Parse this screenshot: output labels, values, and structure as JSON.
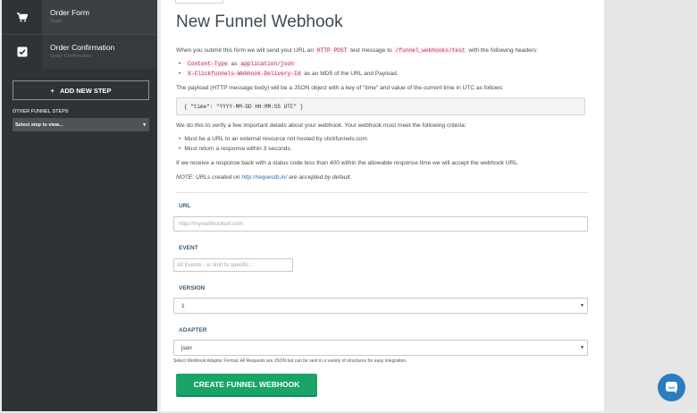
{
  "sidebar": {
    "steps": [
      {
        "name": "Order Form",
        "sub": "Order",
        "icon": "cart-icon"
      },
      {
        "name": "Order Confirmation",
        "sub": "Order Confirmation",
        "icon": "checkbox-icon"
      }
    ],
    "add_step_label": "ADD NEW STEP",
    "other_steps_label": "OTHER FUNNEL STEPS",
    "select_placeholder": "Select step to view..."
  },
  "main": {
    "title": "New Funnel Webhook",
    "intro_1": "When you submit this form we will send your URL an",
    "intro_code_1": "HTTP POST",
    "intro_2": "test message to",
    "intro_code_2": "/funnel_webhooks/test",
    "intro_3": "with the following headers:",
    "headers": [
      {
        "code": "Content-Type",
        "mid": "as",
        "code2": "application/json",
        "tail": ""
      },
      {
        "code": "X-Clickfunnels-Webhook-Delivery-Id",
        "mid": "as an MD5 of the URL and Payload.",
        "code2": "",
        "tail": ""
      }
    ],
    "payload_text": "The payload (HTTP message body) will be a JSON object with a key of \"time\" and value of the current time in UTC as follows:",
    "payload_example": "{ \"time\": \"YYYY-MM-DD HH:MM:SS UTC\" }",
    "verify_text": "We do this to verify a few important details about your webhook. Your webhook must meet the following criteria:",
    "criteria": [
      "Must be a URL to an external resource not hosted by clickfunnels.com",
      "Must return a response within 3 seconds."
    ],
    "accept_text": "If we receive a response back with a status code less than 400 within the allowable response time we will accept the webhook URL.",
    "note_prefix": "NOTE: URLs created on",
    "note_link": "http://requestb.in/",
    "note_suffix": "are accepted by default.",
    "url_label": "URL",
    "url_placeholder": "http://mywebhookurl.com",
    "event_label": "EVENT",
    "event_placeholder": "All Events - or limit to specific...",
    "version_label": "VERSION",
    "version_value": "1",
    "adapter_label": "ADAPTER",
    "adapter_value": "json",
    "adapter_help": "Select Webhook Adaptor Format. All Requests are JSON but can be sent in a variety of structures for easy integration.",
    "create_button": "CREATE FUNNEL WEBHOOK"
  },
  "colors": {
    "primary_green": "#19a567",
    "sidebar_bg": "#2e3336",
    "chat_blue": "#2c7dbd",
    "code_red": "#c7254e"
  }
}
